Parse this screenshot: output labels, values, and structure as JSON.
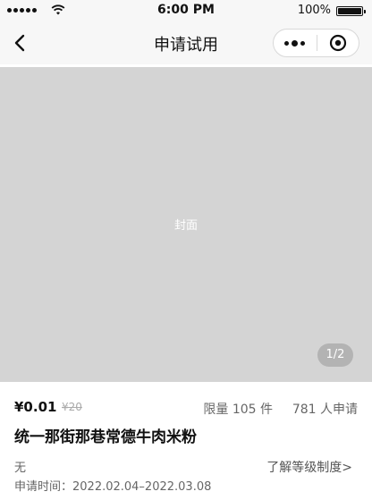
{
  "status_bar": {
    "time": "6:00 PM",
    "battery_percent": "100%",
    "battery_level": 1.0,
    "signal_bars": 5
  },
  "nav": {
    "title": "申请试用",
    "back_icon": "chevron-left-icon",
    "more_icon": "more-dots-icon",
    "close_icon": "target-circle-icon"
  },
  "cover": {
    "label": "封面",
    "page_indicator": "1/2",
    "background": "#d4d4d4"
  },
  "product": {
    "price": "¥0.01",
    "original_price": "¥20",
    "quota": "限量 105 件",
    "applicants": "781 人申请",
    "name": "统一那街那巷常德牛肉米粉",
    "level": "无",
    "level_link": "了解等级制度>",
    "apply_time": "申请时间：2022.02.04–2022.03.08"
  }
}
